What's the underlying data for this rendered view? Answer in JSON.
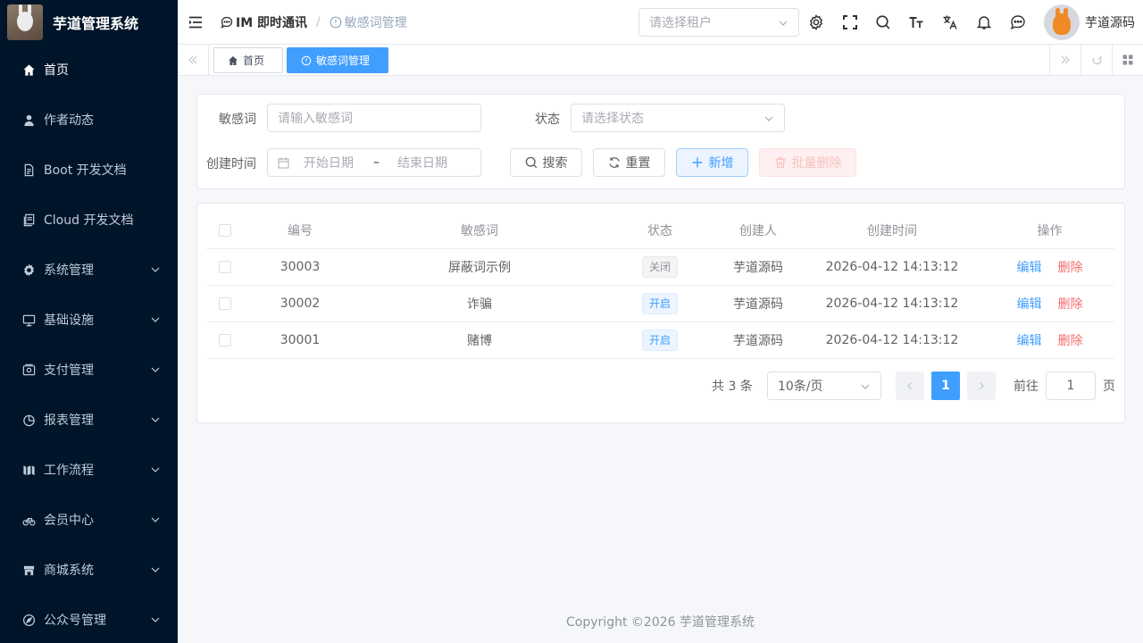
{
  "app": {
    "title": "芋道管理系统"
  },
  "sidebar": {
    "items": [
      {
        "label": "首页",
        "icon": "home-icon",
        "active": true,
        "expandable": false
      },
      {
        "label": "作者动态",
        "icon": "user-icon",
        "expandable": false
      },
      {
        "label": "Boot 开发文档",
        "icon": "document-icon",
        "expandable": false
      },
      {
        "label": "Cloud 开发文档",
        "icon": "documents-icon",
        "expandable": false
      },
      {
        "label": "系统管理",
        "icon": "gear-icon",
        "expandable": true
      },
      {
        "label": "基础设施",
        "icon": "monitor-icon",
        "expandable": true
      },
      {
        "label": "支付管理",
        "icon": "wallet-icon",
        "expandable": true
      },
      {
        "label": "报表管理",
        "icon": "pie-chart-icon",
        "expandable": true
      },
      {
        "label": "工作流程",
        "icon": "flow-icon",
        "expandable": true
      },
      {
        "label": "会员中心",
        "icon": "bicycle-icon",
        "expandable": true
      },
      {
        "label": "商城系统",
        "icon": "shop-icon",
        "expandable": true
      },
      {
        "label": "公众号管理",
        "icon": "compass-icon",
        "expandable": true
      }
    ]
  },
  "header": {
    "breadcrumb": [
      {
        "label": "IM 即时通讯",
        "icon": "chat-icon"
      },
      {
        "label": "敏感词管理",
        "icon": "info-circle-icon"
      }
    ],
    "tenant_placeholder": "请选择租户",
    "tools": [
      "gear-icon",
      "fullscreen-icon",
      "search-icon",
      "font-size-icon",
      "translate-icon",
      "bell-icon",
      "message-icon"
    ],
    "user_name": "芋道源码"
  },
  "tags": [
    {
      "label": "首页",
      "icon": "home-icon",
      "active": false
    },
    {
      "label": "敏感词管理",
      "icon": "info-circle-icon",
      "active": true
    }
  ],
  "search_form": {
    "word_label": "敏感词",
    "word_placeholder": "请输入敏感词",
    "status_label": "状态",
    "status_placeholder": "请选择状态",
    "time_label": "创建时间",
    "start_placeholder": "开始日期",
    "range_sep": "–",
    "end_placeholder": "结束日期",
    "search_btn": "搜索",
    "reset_btn": "重置",
    "add_btn": "新增",
    "batch_delete_btn": "批量删除"
  },
  "table": {
    "headers": [
      "编号",
      "敏感词",
      "状态",
      "创建人",
      "创建时间",
      "操作"
    ],
    "rows": [
      {
        "id": "30003",
        "word": "屏蔽词示例",
        "status": "关闭",
        "status_type": "off",
        "creator": "芋道源码",
        "created": "2026-04-12 14:13:12"
      },
      {
        "id": "30002",
        "word": "诈骗",
        "status": "开启",
        "status_type": "on",
        "creator": "芋道源码",
        "created": "2026-04-12 14:13:12"
      },
      {
        "id": "30001",
        "word": "赌博",
        "status": "开启",
        "status_type": "on",
        "creator": "芋道源码",
        "created": "2026-04-12 14:13:12"
      }
    ],
    "edit_label": "编辑",
    "delete_label": "删除"
  },
  "pagination": {
    "total_text": "共 3 条",
    "page_size": "10条/页",
    "current_page": "1",
    "goto_label": "前往",
    "goto_value": "1",
    "page_suffix": "页"
  },
  "footer": {
    "text": "Copyright ©2026 芋道管理系统"
  },
  "colors": {
    "sidebar_bg": "#001529",
    "primary": "#409eff",
    "danger": "#f56c6c"
  }
}
